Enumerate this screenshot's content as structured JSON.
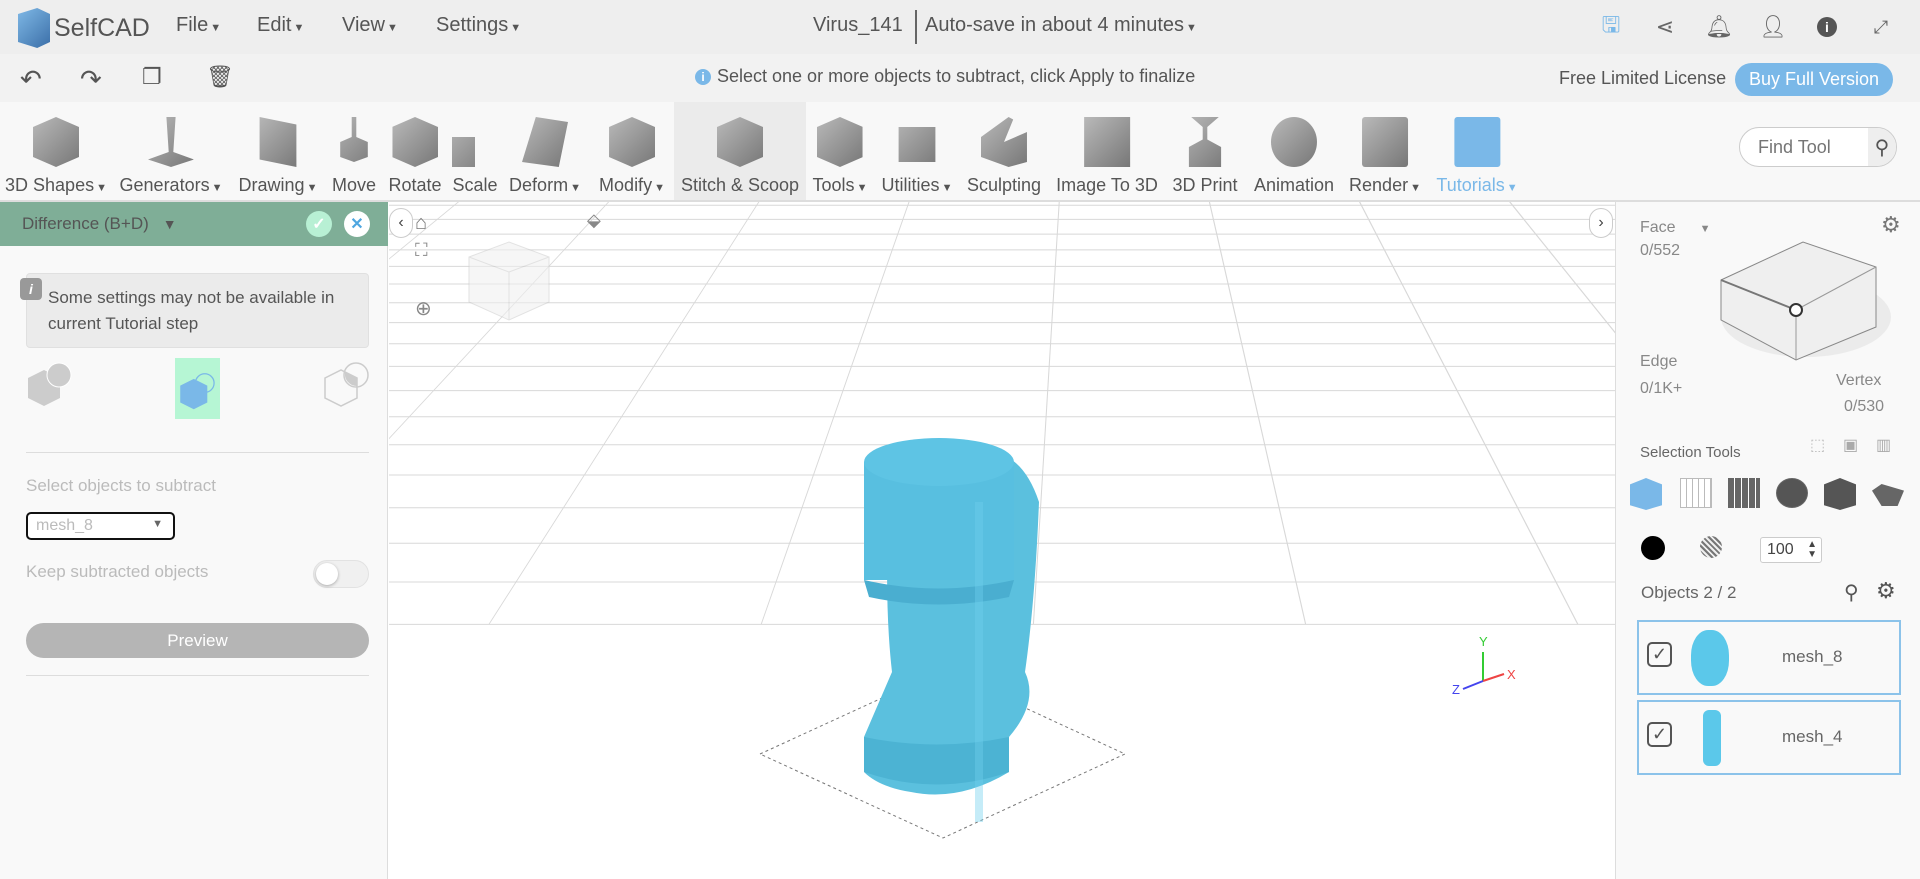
{
  "app": {
    "name": "SelfCAD"
  },
  "menu": [
    "File",
    "Edit",
    "View",
    "Settings"
  ],
  "document": {
    "title": "Virus_141",
    "autosave": "Auto-save in about 4 minutes"
  },
  "top_icons": [
    "save-icon",
    "share-icon",
    "bell-icon",
    "user-icon",
    "info-icon",
    "fullscreen-icon"
  ],
  "hint": "Select one or more objects to subtract, click Apply to finalize",
  "license": {
    "label": "Free Limited License",
    "buy": "Buy Full Version"
  },
  "toolbar": {
    "items": [
      {
        "label": "3D Shapes",
        "dropdown": true
      },
      {
        "label": "Generators",
        "dropdown": true
      },
      {
        "label": "Drawing",
        "dropdown": true
      },
      {
        "label": "Move",
        "dropdown": false
      },
      {
        "label": "Rotate",
        "dropdown": false
      },
      {
        "label": "Scale",
        "dropdown": false
      },
      {
        "label": "Deform",
        "dropdown": true
      },
      {
        "label": "Modify",
        "dropdown": true
      },
      {
        "label": "Stitch & Scoop",
        "dropdown": false
      },
      {
        "label": "Tools",
        "dropdown": true
      },
      {
        "label": "Utilities",
        "dropdown": true
      },
      {
        "label": "Sculpting",
        "dropdown": false
      },
      {
        "label": "Image To 3D",
        "dropdown": false
      },
      {
        "label": "3D Print",
        "dropdown": false
      },
      {
        "label": "Animation",
        "dropdown": false
      },
      {
        "label": "Render",
        "dropdown": true
      },
      {
        "label": "Tutorials",
        "dropdown": true
      }
    ],
    "find_tool_placeholder": "Find Tool"
  },
  "left_panel": {
    "title": "Difference (B+D)",
    "notice": "Some settings may not be available in current Tutorial step",
    "select_label": "Select objects to subtract",
    "select_value": "mesh_8",
    "keep_label": "Keep subtracted objects",
    "keep_value": false,
    "preview": "Preview"
  },
  "right_panel": {
    "face_label": "Face",
    "face_count": "0/552",
    "edge_label": "Edge",
    "edge_count": "0/1K+",
    "vertex_label": "Vertex",
    "vertex_count": "0/530",
    "selection_tools": "Selection Tools",
    "opacity": "100",
    "objects_label": "Objects 2 / 2",
    "objects": [
      {
        "name": "mesh_8",
        "checked": true
      },
      {
        "name": "mesh_4",
        "checked": true
      }
    ]
  },
  "colors": {
    "accent": "#7ab8e8",
    "panel_header": "#7fae97",
    "mesh": "#5bc0de"
  }
}
